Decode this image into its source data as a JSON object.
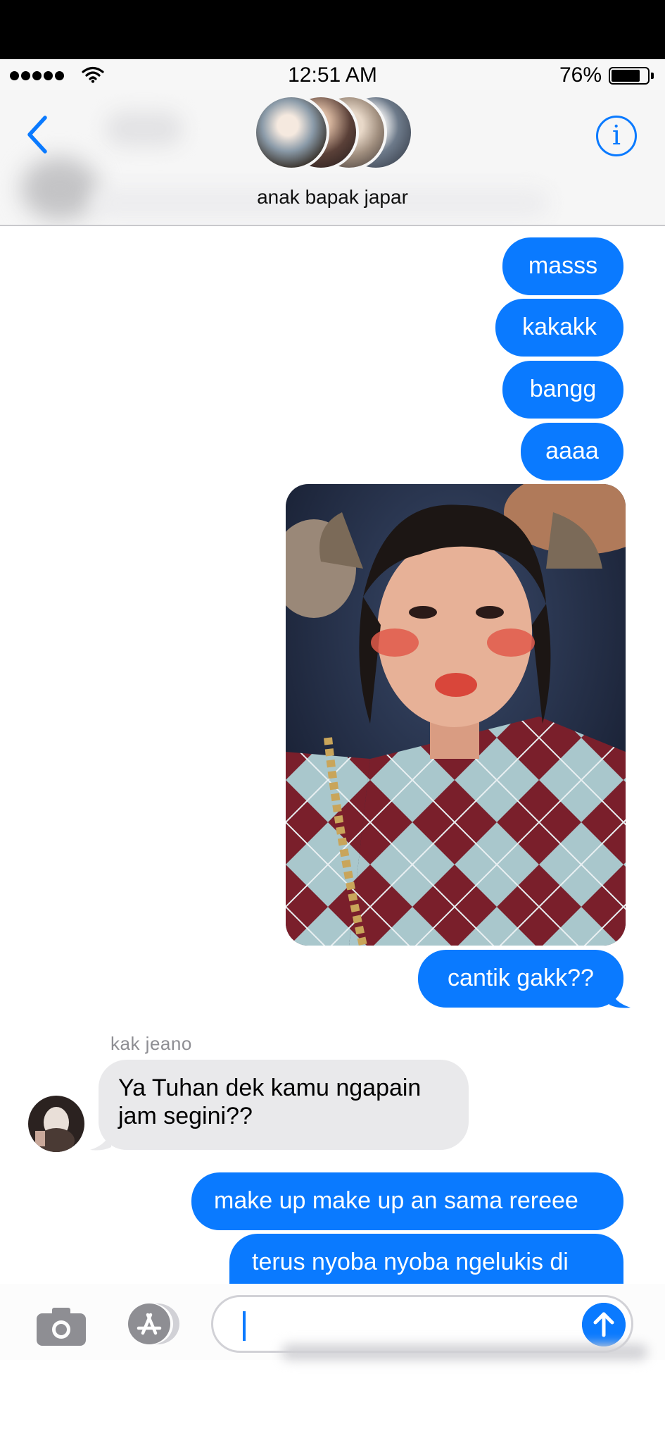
{
  "status_bar": {
    "time": "12:51 AM",
    "battery_percent": "76%",
    "battery_level": 0.76
  },
  "header": {
    "group_name": "anak bapak japar",
    "back_icon": "chevron-left-icon",
    "info_icon": "info-icon",
    "accent_color": "#0a7aff"
  },
  "messages": {
    "out_1": "masss",
    "out_2": "kakakk",
    "out_3": "bangg",
    "out_4": "aaaa",
    "out_5": "cantik gakk??",
    "in_sender": "kak jeano",
    "in_1": "Ya Tuhan dek kamu ngapain jam segini??",
    "out_6": "make up make up an sama rereee",
    "out_7": "terus nyoba nyoba ngelukis di"
  },
  "composer": {
    "camera_icon": "camera-icon",
    "apps_icon": "app-store-icon",
    "send_icon": "arrow-up-icon",
    "input_value": ""
  }
}
